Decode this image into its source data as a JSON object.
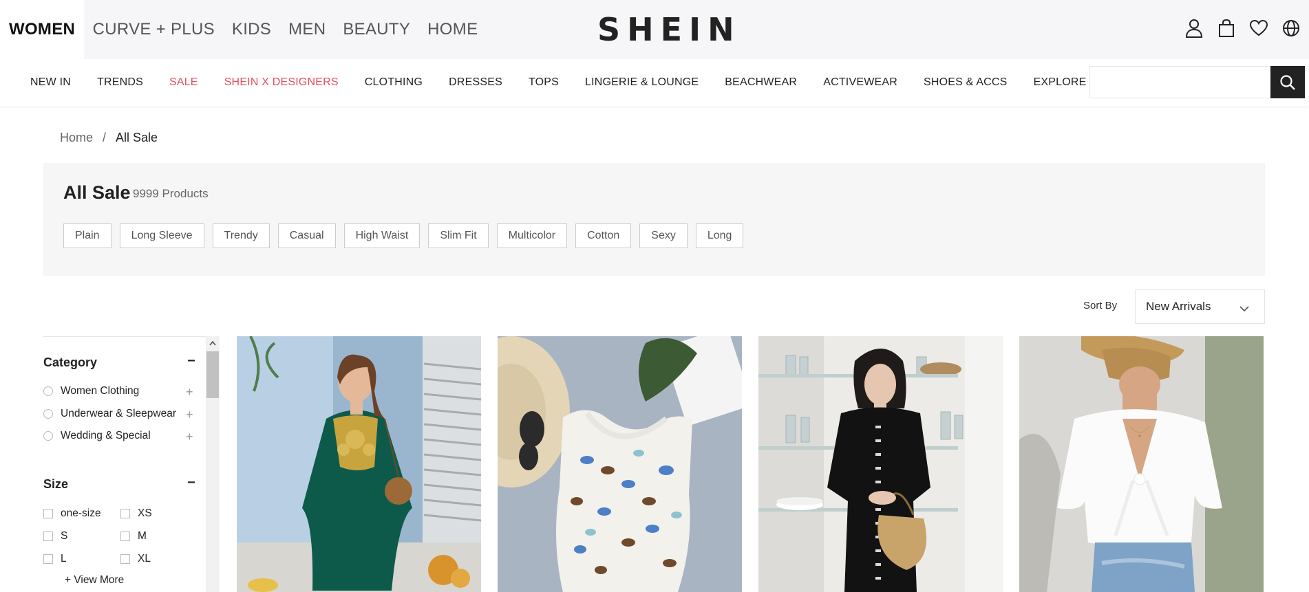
{
  "header": {
    "category_tabs": [
      "WOMEN",
      "CURVE + PLUS",
      "KIDS",
      "MEN",
      "BEAUTY",
      "HOME"
    ],
    "logo": "SHEIN",
    "icons": [
      "user-icon",
      "bag-icon",
      "heart-icon",
      "globe-icon"
    ]
  },
  "nav": {
    "items": [
      "NEW IN",
      "TRENDS",
      "SALE",
      "SHEIN X DESIGNERS",
      "CLOTHING",
      "DRESSES",
      "TOPS",
      "LINGERIE & LOUNGE",
      "BEACHWEAR",
      "ACTIVEWEAR",
      "SHOES & ACCS",
      "EXPLORE"
    ],
    "highlight_color": "#e64e5a",
    "search_placeholder": ""
  },
  "breadcrumb": {
    "home": "Home",
    "separator": "/",
    "current": "All Sale"
  },
  "listing": {
    "title": "All Sale",
    "count": "9999 Products",
    "tags": [
      "Plain",
      "Long Sleeve",
      "Trendy",
      "Casual",
      "High Waist",
      "Slim Fit",
      "Multicolor",
      "Cotton",
      "Sexy",
      "Long"
    ]
  },
  "sort": {
    "label": "Sort By",
    "selected": "New Arrivals"
  },
  "filters": {
    "category": {
      "title": "Category",
      "collapse_symbol": "−",
      "items": [
        "Women Clothing",
        "Underwear & Sleepwear",
        "Wedding & Special"
      ],
      "expand_symbol": "+"
    },
    "size": {
      "title": "Size",
      "collapse_symbol": "−",
      "items": [
        "one-size",
        "XS",
        "S",
        "M",
        "L",
        "XL"
      ],
      "view_more": "+ View More"
    }
  },
  "products": [
    {
      "name": "green embroidered kaftan dress"
    },
    {
      "name": "butterfly print tank top"
    },
    {
      "name": "black puff sleeve dress"
    },
    {
      "name": "white eyelet tie front blouse"
    }
  ]
}
